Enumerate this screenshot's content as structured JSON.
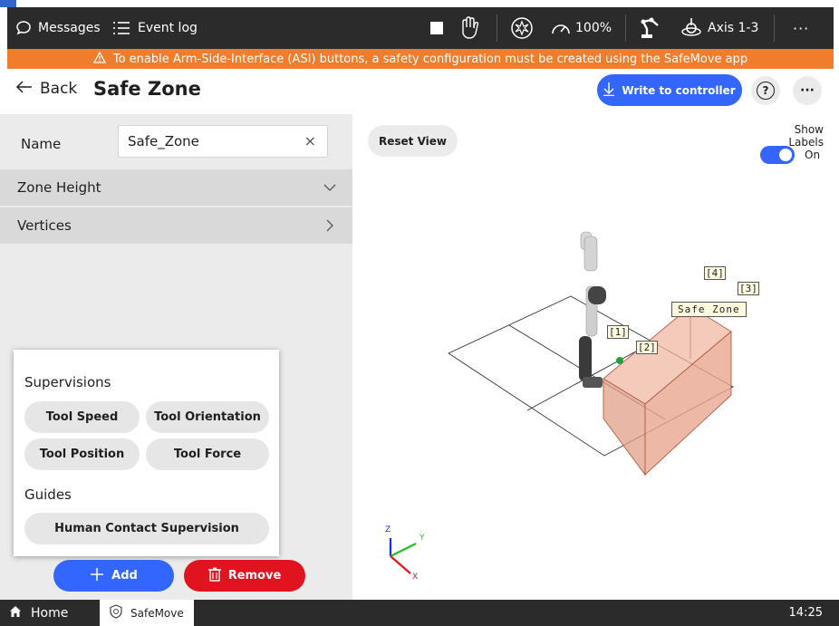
{
  "topbar": {
    "messages_label": "Messages",
    "eventlog_label": "Event log",
    "speed_label": "100%",
    "axis_label": "Axis 1-3",
    "more_label": "···"
  },
  "warning": {
    "text": "To enable Arm-Side-Interface (ASI) buttons, a safety configuration must be created using the SafeMove app"
  },
  "header": {
    "back_label": "Back",
    "title": "Safe Zone",
    "write_label": "Write to controller",
    "help_label": "?",
    "more_label": "···"
  },
  "left_panel": {
    "name_label": "Name",
    "name_value": "Safe_Zone",
    "clear_label": "×",
    "sections": [
      {
        "label": "Zone Height",
        "state": "collapsed-down"
      },
      {
        "label": "Vertices",
        "state": "collapsed-right"
      }
    ]
  },
  "popup": {
    "supervisions_heading": "Supervisions",
    "supervisions": [
      "Tool Speed",
      "Tool Orientation",
      "Tool Position",
      "Tool Force"
    ],
    "guides_heading": "Guides",
    "guides": [
      "Human Contact Supervision"
    ]
  },
  "actions": {
    "add_label": "Add",
    "remove_label": "Remove"
  },
  "canvas": {
    "reset_label": "Reset View",
    "show_labels_label": "Show Labels",
    "toggle_state": "On",
    "zone_label": "Safe Zone",
    "vertex_labels": [
      "[1]",
      "[2]",
      "[3]",
      "[4]"
    ],
    "axis_labels": [
      "Z",
      "Y",
      "X"
    ]
  },
  "taskbar": {
    "home_label": "Home",
    "app_label": "SafeMove",
    "time": "14:25"
  },
  "colors": {
    "accent": "#3366ff",
    "warning": "#f07d2c",
    "danger": "#e0131f",
    "zone_fill": "#e8a890",
    "dark_bar": "#2b2b2b"
  }
}
